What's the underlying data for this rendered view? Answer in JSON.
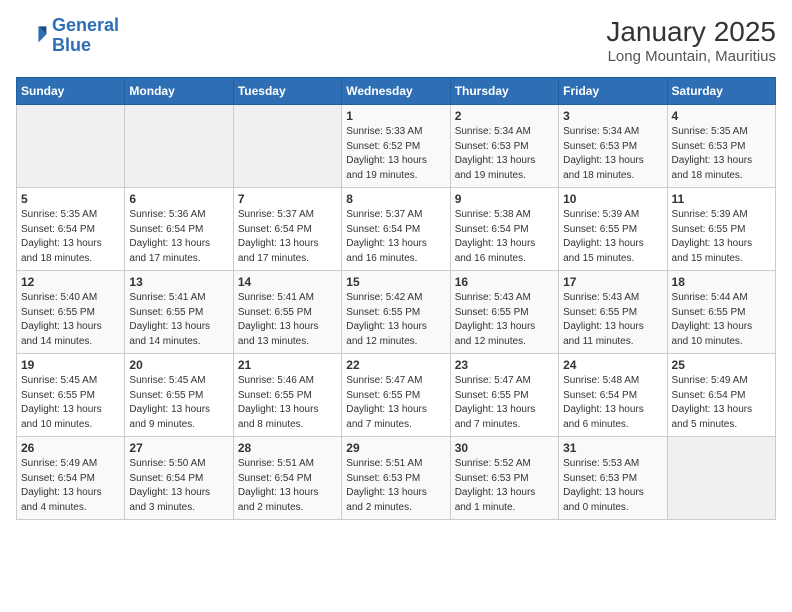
{
  "logo": {
    "line1": "General",
    "line2": "Blue"
  },
  "title": "January 2025",
  "subtitle": "Long Mountain, Mauritius",
  "weekdays": [
    "Sunday",
    "Monday",
    "Tuesday",
    "Wednesday",
    "Thursday",
    "Friday",
    "Saturday"
  ],
  "weeks": [
    [
      {
        "day": "",
        "info": ""
      },
      {
        "day": "",
        "info": ""
      },
      {
        "day": "",
        "info": ""
      },
      {
        "day": "1",
        "info": "Sunrise: 5:33 AM\nSunset: 6:52 PM\nDaylight: 13 hours\nand 19 minutes."
      },
      {
        "day": "2",
        "info": "Sunrise: 5:34 AM\nSunset: 6:53 PM\nDaylight: 13 hours\nand 19 minutes."
      },
      {
        "day": "3",
        "info": "Sunrise: 5:34 AM\nSunset: 6:53 PM\nDaylight: 13 hours\nand 18 minutes."
      },
      {
        "day": "4",
        "info": "Sunrise: 5:35 AM\nSunset: 6:53 PM\nDaylight: 13 hours\nand 18 minutes."
      }
    ],
    [
      {
        "day": "5",
        "info": "Sunrise: 5:35 AM\nSunset: 6:54 PM\nDaylight: 13 hours\nand 18 minutes."
      },
      {
        "day": "6",
        "info": "Sunrise: 5:36 AM\nSunset: 6:54 PM\nDaylight: 13 hours\nand 17 minutes."
      },
      {
        "day": "7",
        "info": "Sunrise: 5:37 AM\nSunset: 6:54 PM\nDaylight: 13 hours\nand 17 minutes."
      },
      {
        "day": "8",
        "info": "Sunrise: 5:37 AM\nSunset: 6:54 PM\nDaylight: 13 hours\nand 16 minutes."
      },
      {
        "day": "9",
        "info": "Sunrise: 5:38 AM\nSunset: 6:54 PM\nDaylight: 13 hours\nand 16 minutes."
      },
      {
        "day": "10",
        "info": "Sunrise: 5:39 AM\nSunset: 6:55 PM\nDaylight: 13 hours\nand 15 minutes."
      },
      {
        "day": "11",
        "info": "Sunrise: 5:39 AM\nSunset: 6:55 PM\nDaylight: 13 hours\nand 15 minutes."
      }
    ],
    [
      {
        "day": "12",
        "info": "Sunrise: 5:40 AM\nSunset: 6:55 PM\nDaylight: 13 hours\nand 14 minutes."
      },
      {
        "day": "13",
        "info": "Sunrise: 5:41 AM\nSunset: 6:55 PM\nDaylight: 13 hours\nand 14 minutes."
      },
      {
        "day": "14",
        "info": "Sunrise: 5:41 AM\nSunset: 6:55 PM\nDaylight: 13 hours\nand 13 minutes."
      },
      {
        "day": "15",
        "info": "Sunrise: 5:42 AM\nSunset: 6:55 PM\nDaylight: 13 hours\nand 12 minutes."
      },
      {
        "day": "16",
        "info": "Sunrise: 5:43 AM\nSunset: 6:55 PM\nDaylight: 13 hours\nand 12 minutes."
      },
      {
        "day": "17",
        "info": "Sunrise: 5:43 AM\nSunset: 6:55 PM\nDaylight: 13 hours\nand 11 minutes."
      },
      {
        "day": "18",
        "info": "Sunrise: 5:44 AM\nSunset: 6:55 PM\nDaylight: 13 hours\nand 10 minutes."
      }
    ],
    [
      {
        "day": "19",
        "info": "Sunrise: 5:45 AM\nSunset: 6:55 PM\nDaylight: 13 hours\nand 10 minutes."
      },
      {
        "day": "20",
        "info": "Sunrise: 5:45 AM\nSunset: 6:55 PM\nDaylight: 13 hours\nand 9 minutes."
      },
      {
        "day": "21",
        "info": "Sunrise: 5:46 AM\nSunset: 6:55 PM\nDaylight: 13 hours\nand 8 minutes."
      },
      {
        "day": "22",
        "info": "Sunrise: 5:47 AM\nSunset: 6:55 PM\nDaylight: 13 hours\nand 7 minutes."
      },
      {
        "day": "23",
        "info": "Sunrise: 5:47 AM\nSunset: 6:55 PM\nDaylight: 13 hours\nand 7 minutes."
      },
      {
        "day": "24",
        "info": "Sunrise: 5:48 AM\nSunset: 6:54 PM\nDaylight: 13 hours\nand 6 minutes."
      },
      {
        "day": "25",
        "info": "Sunrise: 5:49 AM\nSunset: 6:54 PM\nDaylight: 13 hours\nand 5 minutes."
      }
    ],
    [
      {
        "day": "26",
        "info": "Sunrise: 5:49 AM\nSunset: 6:54 PM\nDaylight: 13 hours\nand 4 minutes."
      },
      {
        "day": "27",
        "info": "Sunrise: 5:50 AM\nSunset: 6:54 PM\nDaylight: 13 hours\nand 3 minutes."
      },
      {
        "day": "28",
        "info": "Sunrise: 5:51 AM\nSunset: 6:54 PM\nDaylight: 13 hours\nand 2 minutes."
      },
      {
        "day": "29",
        "info": "Sunrise: 5:51 AM\nSunset: 6:53 PM\nDaylight: 13 hours\nand 2 minutes."
      },
      {
        "day": "30",
        "info": "Sunrise: 5:52 AM\nSunset: 6:53 PM\nDaylight: 13 hours\nand 1 minute."
      },
      {
        "day": "31",
        "info": "Sunrise: 5:53 AM\nSunset: 6:53 PM\nDaylight: 13 hours\nand 0 minutes."
      },
      {
        "day": "",
        "info": ""
      }
    ]
  ]
}
